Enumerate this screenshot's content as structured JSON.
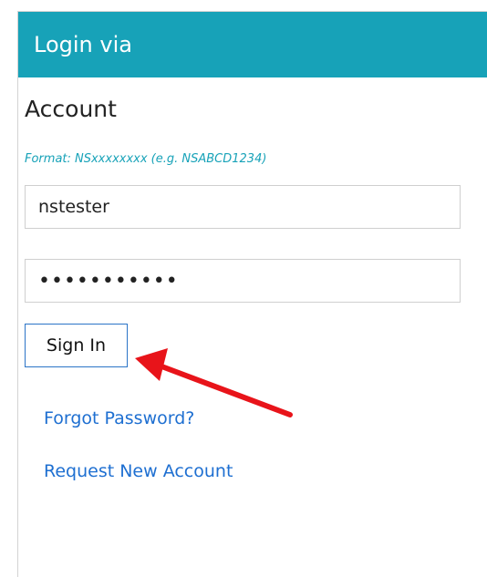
{
  "header": {
    "title": "Login via"
  },
  "account": {
    "section_title": "Account",
    "format_hint": "Format: NSxxxxxxxx (e.g. NSABCD1234)",
    "username_value": "nstester",
    "password_value": "•••••••••••"
  },
  "actions": {
    "sign_in_label": "Sign In",
    "forgot_password_label": "Forgot Password?",
    "request_account_label": "Request New Account"
  },
  "annotation": {
    "arrow_color": "#e8141a",
    "points_to": "sign-in-button"
  },
  "colors": {
    "header_bg": "#17a2b8",
    "link": "#1e6fd1",
    "hint": "#17a2b8"
  }
}
